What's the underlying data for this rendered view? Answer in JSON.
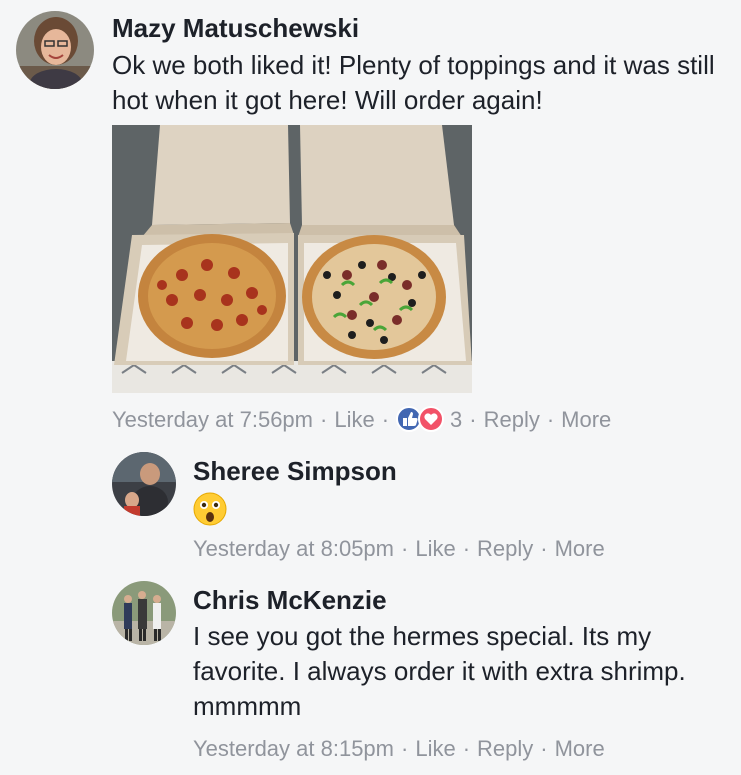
{
  "comments": [
    {
      "author": "Mazy Matuschewski",
      "text": "Ok we both liked it! Plenty of toppings and it was still hot when it got here! Will order again!",
      "time": "Yesterday at 7:56pm",
      "like_label": "Like",
      "reaction_count": "3",
      "reply_label": "Reply",
      "more_label": "More",
      "reaction_icons": [
        "like-reaction-icon",
        "love-reaction-icon"
      ]
    },
    {
      "author": "Sheree Simpson",
      "text": "😮",
      "time": "Yesterday at 8:05pm",
      "like_label": "Like",
      "reply_label": "Reply",
      "more_label": "More"
    },
    {
      "author": "Chris McKenzie",
      "text": "I see you got the hermes special. Its my favorite. I always order it with extra shrimp. mmmmm",
      "time": "Yesterday at 8:15pm",
      "like_label": "Like",
      "reply_label": "Reply",
      "more_label": "More"
    }
  ],
  "colors": {
    "text": "#1d2129",
    "meta": "#90949c",
    "like_blue": "#4267b2",
    "love_red": "#f25268",
    "background": "#f5f6f7"
  }
}
